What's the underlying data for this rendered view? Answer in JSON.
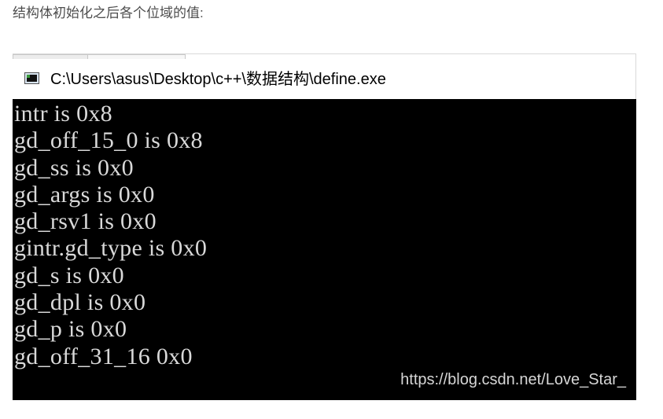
{
  "caption": "结构体初始化之后各个位域的值:",
  "window": {
    "title": "C:\\Users\\asus\\Desktop\\c++\\数据结构\\define.exe",
    "icon": "console-window-icon"
  },
  "console": {
    "lines": [
      "intr is 0x8",
      "gd_off_15_0 is 0x8",
      "gd_ss is 0x0",
      "gd_args is 0x0",
      "gd_rsv1 is 0x0",
      "gintr.gd_type is 0x0",
      "gd_s is 0x0",
      "gd_dpl is 0x0",
      "gd_p is 0x0",
      "gd_off_31_16 0x0"
    ],
    "background": "#000000",
    "foreground": "#d9d9d9"
  },
  "watermark": "https://blog.csdn.net/Love_Star_"
}
